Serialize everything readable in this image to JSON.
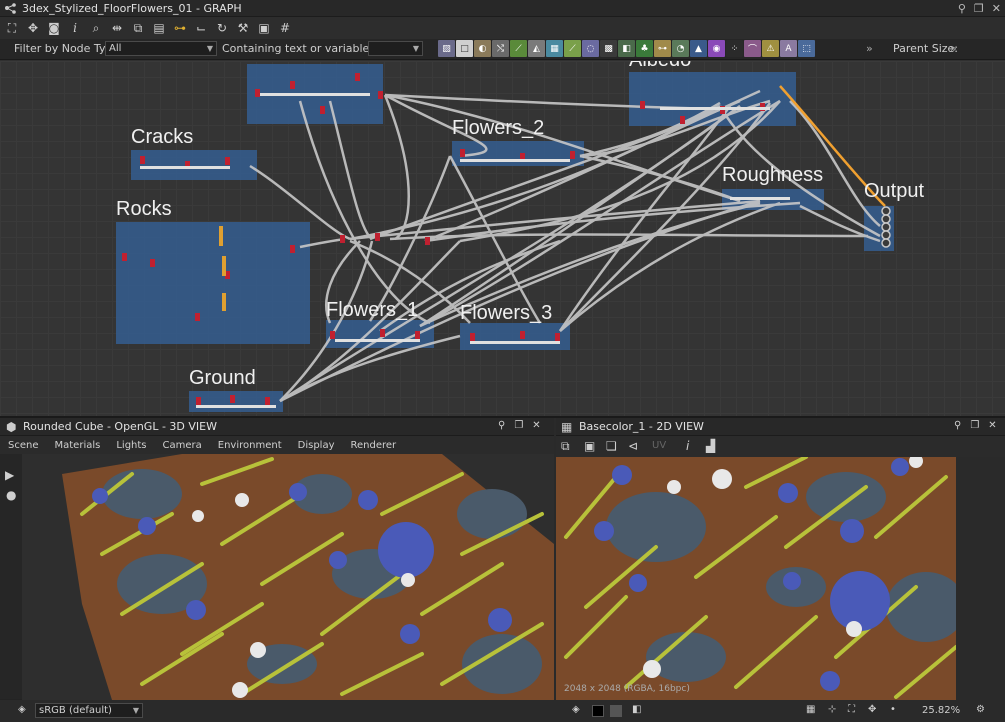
{
  "graph": {
    "title": "3dex_Stylized_FloorFlowers_01 - GRAPH",
    "filter_label": "Filter by Node Type",
    "filter_value": "All",
    "contains_label": "Containing text or variable",
    "contains_value": "",
    "parent_size_label": "Parent Size:",
    "frames": [
      {
        "id": "cracks",
        "label": "Cracks"
      },
      {
        "id": "rocks",
        "label": "Rocks"
      },
      {
        "id": "flowers2",
        "label": "Flowers_2"
      },
      {
        "id": "albedo",
        "label": "Albedo"
      },
      {
        "id": "roughness",
        "label": "Roughness"
      },
      {
        "id": "output",
        "label": "Output"
      },
      {
        "id": "flowers1",
        "label": "Flowers_1"
      },
      {
        "id": "flowers3",
        "label": "Flowers_3"
      },
      {
        "id": "ground",
        "label": "Ground"
      }
    ]
  },
  "view3d": {
    "title": "Rounded Cube - OpenGL - 3D VIEW",
    "menu": [
      "Scene",
      "Materials",
      "Lights",
      "Camera",
      "Environment",
      "Display",
      "Renderer"
    ],
    "colorspace": "sRGB (default)"
  },
  "view2d": {
    "title": "Basecolor_1 - 2D VIEW",
    "uv_label": "UV",
    "resolution": "2048 x 2048 (RGBA, 16bpc)",
    "zoom": "25.82%"
  },
  "colors": {
    "frame": "#346298",
    "wire": "#c8c8c8",
    "wire_highlight": "#f0a030",
    "grass": "#b8c23a",
    "dirt": "#7a4a2a",
    "rock": "#4a5a6a",
    "flower": "#4a5ab8"
  }
}
